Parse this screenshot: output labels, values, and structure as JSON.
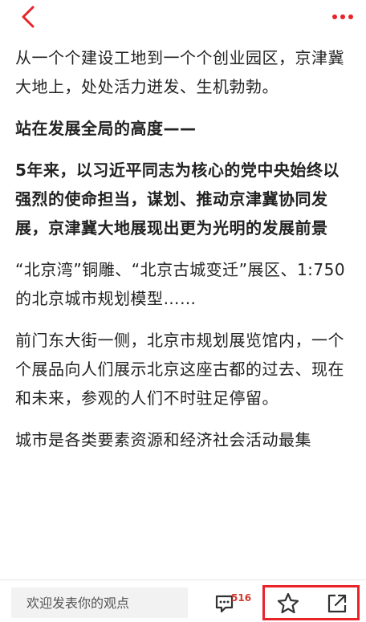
{
  "header": {
    "back_icon": "chevron-left-icon",
    "more_icon": "more-dots-icon",
    "accent_color": "#e8232a"
  },
  "article": {
    "paragraphs": [
      {
        "text": "从一个个建设工地到一个个创业园区，京津冀大地上，处处活力迸发、生机勃勃。",
        "bold": false
      },
      {
        "text": "站在发展全局的高度——",
        "bold": true
      },
      {
        "text": "5年来，以习近平同志为核心的党中央始终以强烈的使命担当，谋划、推动京津冀协同发展，京津冀大地展现出更为光明的发展前景",
        "bold": true
      },
      {
        "text": "“北京湾”铜雕、“北京古城变迁”展区、1:750的北京城市规划模型……",
        "bold": false
      },
      {
        "text": "前门东大街一侧，北京市规划展览馆内，一个个展品向人们展示北京这座古都的过去、现在和未来，参观的人们不时驻足停留。",
        "bold": false
      },
      {
        "text": "城市是各类要素资源和经济社会活动最集",
        "bold": false
      }
    ]
  },
  "bottom_bar": {
    "comment_placeholder": "欢迎发表你的观点",
    "comment_count": "516",
    "comment_icon": "comment-icon",
    "favorite_icon": "star-icon",
    "share_icon": "share-icon",
    "highlight_color": "#e8232a"
  }
}
